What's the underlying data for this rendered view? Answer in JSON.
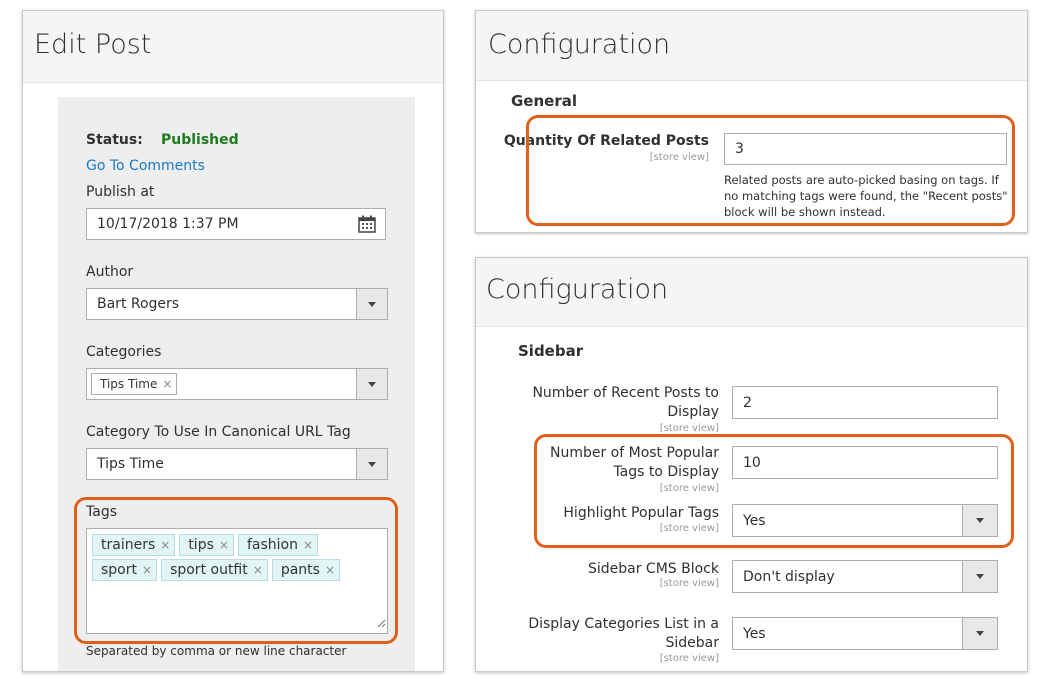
{
  "edit_post": {
    "title": "Edit Post",
    "status_label": "Status:",
    "status_value": "Published",
    "go_to_comments": "Go To Comments",
    "publish_at_label": "Publish at",
    "publish_at_value": "10/17/2018 1:37 PM",
    "author_label": "Author",
    "author_value": "Bart Rogers",
    "categories_label": "Categories",
    "categories_chip": "Tips Time",
    "canonical_label": "Category To Use In Canonical URL Tag",
    "canonical_value": "Tips Time",
    "tags_label": "Tags",
    "tags": [
      "trainers",
      "tips",
      "fashion",
      "sport",
      "sport outfit",
      "pants"
    ],
    "tags_note": "Separated by comma or new line character",
    "colors": {
      "status_green": "#1e7c1e",
      "link_blue": "#1979c3",
      "highlight": "#e0601b"
    }
  },
  "config_general": {
    "title": "Configuration",
    "section": "General",
    "related_label": "Quantity Of Related Posts",
    "scope": "[store view]",
    "related_value": "3",
    "note": "Related posts are auto-picked basing on tags. If no matching tags were found, the \"Recent posts\" block will be shown instead."
  },
  "config_sidebar": {
    "title": "Configuration",
    "section": "Sidebar",
    "scope": "[store view]",
    "recent_label": "Number of Recent Posts to Display",
    "recent_value": "2",
    "popular_label": "Number of Most Popular Tags to Display",
    "popular_value": "10",
    "highlight_label": "Highlight Popular Tags",
    "highlight_value": "Yes",
    "cms_label": "Sidebar CMS Block",
    "cms_value": "Don't display",
    "catlist_label": "Display Categories List in a Sidebar",
    "catlist_value": "Yes"
  }
}
